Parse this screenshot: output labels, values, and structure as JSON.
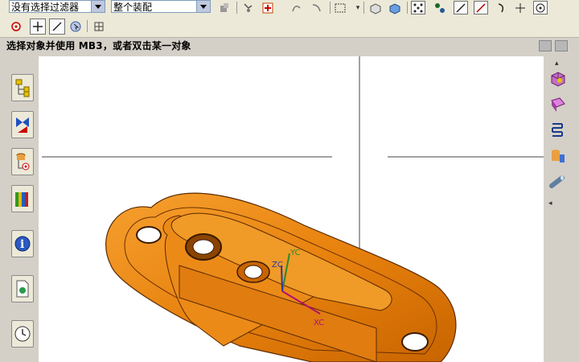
{
  "toolbar": {
    "filter_select": "没有选择过滤器",
    "assembly_select": "整个装配"
  },
  "status": {
    "prompt": "选择对象并使用 MB3，或者双击某一对象"
  },
  "viewport": {
    "axis_labels": {
      "zc": "ZC",
      "yc": "YC",
      "xc": "XC"
    },
    "part_color": "#e8820e"
  },
  "icons": {
    "toolbar_row1": [
      "filter-dropdown-icon",
      "assembly-dropdown-icon",
      "snap-icon",
      "point-icon",
      "select-plus-icon",
      "curve-icon",
      "rectangle-select-icon",
      "shaded-icon",
      "solid-icon",
      "grid-icon",
      "line-icon",
      "arc-icon",
      "crosshair-icon",
      "circle-icon"
    ],
    "toolbar_row2": [
      "circle-target-icon",
      "plus-icon",
      "slash-icon",
      "cursor-icon",
      "grid-icon"
    ],
    "left_bar": [
      "assembly-navigator-icon",
      "constraint-icon",
      "part-navigator-icon",
      "reuse-library-icon",
      "info-icon",
      "document-icon",
      "history-icon"
    ],
    "right_bar": [
      "cube-icon",
      "face-icon",
      "spring-icon",
      "cylinder-icon",
      "pipe-icon"
    ]
  }
}
